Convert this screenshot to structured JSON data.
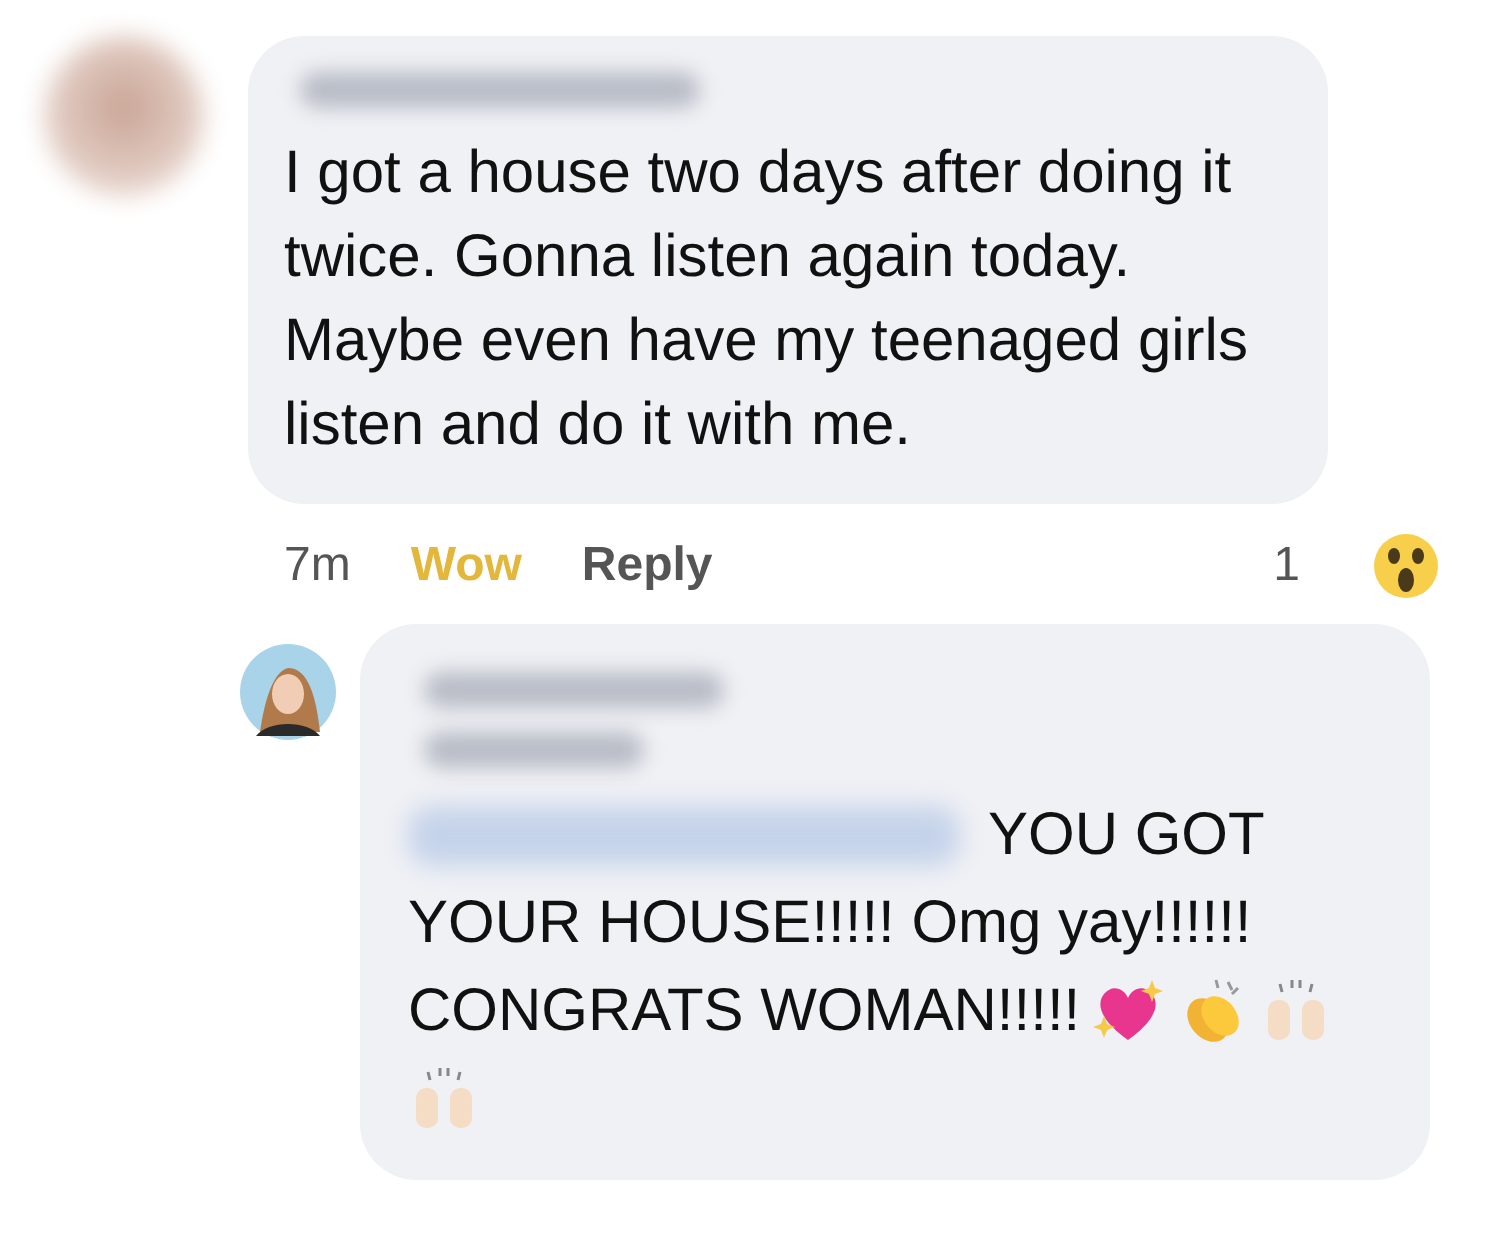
{
  "comment": {
    "text": "I got a house two days after doing it twice. Gonna listen again today. Maybe even have my teenaged girls listen and do it with me.",
    "actions": [
      {
        "label": "7m",
        "kind": "time"
      },
      {
        "label": "Wow",
        "kind": "reaction"
      },
      {
        "label": "Reply",
        "kind": "link"
      }
    ],
    "reaction_count": "1"
  },
  "reply": {
    "lines": [
      "YOU GOT",
      "YOUR HOUSE!!!!! Omg yay!!!!!!",
      "CONGRATS WOMAN!!!!!"
    ]
  }
}
